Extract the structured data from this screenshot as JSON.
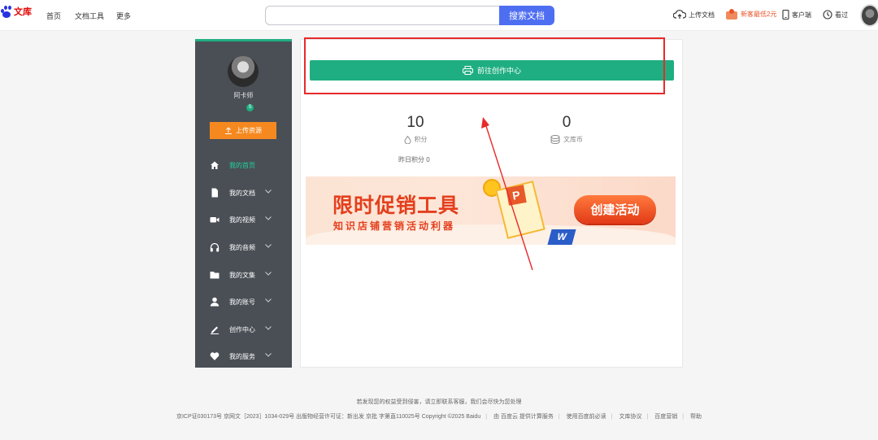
{
  "header": {
    "logo_text": "文库",
    "nav": [
      "首页",
      "文档工具",
      "更多"
    ],
    "search_placeholder": "",
    "search_button": "搜索文档",
    "upload_label": "上传文档",
    "promo_label": "新客最低2元",
    "client_label": "客户端",
    "history_label": "看过"
  },
  "sidebar": {
    "user_name": "阿卡师",
    "badge": "S",
    "upload_button": "上传资源",
    "items": [
      {
        "label": "我的首页",
        "icon": "home-icon",
        "active": true,
        "chevron": false
      },
      {
        "label": "我的文档",
        "icon": "document-icon",
        "active": false,
        "chevron": true
      },
      {
        "label": "我的视频",
        "icon": "video-icon",
        "active": false,
        "chevron": true
      },
      {
        "label": "我的音频",
        "icon": "headphones-icon",
        "active": false,
        "chevron": true
      },
      {
        "label": "我的文集",
        "icon": "folder-icon",
        "active": false,
        "chevron": true
      },
      {
        "label": "我的账号",
        "icon": "user-icon",
        "active": false,
        "chevron": true
      },
      {
        "label": "创作中心",
        "icon": "pen-icon",
        "active": false,
        "chevron": true
      },
      {
        "label": "我的服务",
        "icon": "heart-icon",
        "active": false,
        "chevron": true
      }
    ]
  },
  "main": {
    "creation_button": "前往创作中心",
    "stats": [
      {
        "value": "10",
        "label": "积分",
        "icon": "points-icon"
      },
      {
        "value": "0",
        "label": "文库币",
        "icon": "coins-icon"
      }
    ],
    "yesterday_points": "昨日积分 0",
    "banner": {
      "title": "限时促销工具",
      "subtitle": "知识店铺营销活动利器",
      "cta": "创建活动"
    }
  },
  "footer": {
    "line1": "若发现您的权益受到侵害，请立即联系客服，我们会尽快为您处理",
    "line2_main": "京ICP证030173号 京网文［2023］1034-029号 出版物经营许可证：新出发 京批 字第直110025号 Copyright ©2025 Baidu",
    "line2_links": [
      "由 百度云 提供计算服务",
      "使用百度前必读",
      "文库协议",
      "百度营销",
      "帮助"
    ]
  },
  "colors": {
    "accent_green": "#1fae81",
    "sidebar_bg": "#4a4f56",
    "upload_orange": "#f5891f",
    "search_blue": "#4e6ef2",
    "annotation_red": "#e82a2a"
  }
}
